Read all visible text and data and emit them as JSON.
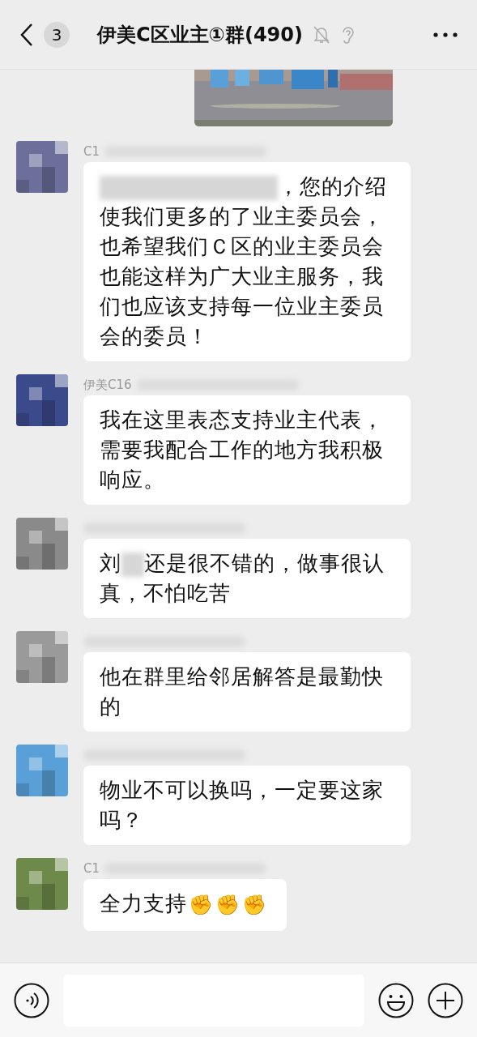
{
  "header": {
    "unread_count": "3",
    "title": "伊美C区业主①群(490)",
    "muted": true
  },
  "messages": [
    {
      "sender": "C1",
      "segments": [
        {
          "kind": "redaction"
        },
        {
          "kind": "text",
          "text": "，您的介绍使我们更多的了业主委员会，也希望我们Ｃ区的业主委员会也能这样为广大业主服务，我们也应该支持每一位业主委员会的委员！"
        }
      ]
    },
    {
      "sender": "伊美C16",
      "segments": [
        {
          "kind": "text",
          "text": "我在这里表态支持业主代表，需要我配合工作的地方我积极响应。"
        }
      ]
    },
    {
      "segments": [
        {
          "kind": "text",
          "text": "刘"
        },
        {
          "kind": "redaction"
        },
        {
          "kind": "text",
          "text": "还是很不错的，做事很认真，不怕吃苦"
        }
      ]
    },
    {
      "segments": [
        {
          "kind": "text",
          "text": "他在群里给邻居解答是最勤快的"
        }
      ]
    },
    {
      "segments": [
        {
          "kind": "text",
          "text": "物业不可以换吗，一定要这家吗？"
        }
      ]
    },
    {
      "sender": "C1",
      "segments": [
        {
          "kind": "text",
          "text": "全力支持"
        },
        {
          "kind": "text",
          "text": "✊✊✊"
        }
      ]
    }
  ]
}
